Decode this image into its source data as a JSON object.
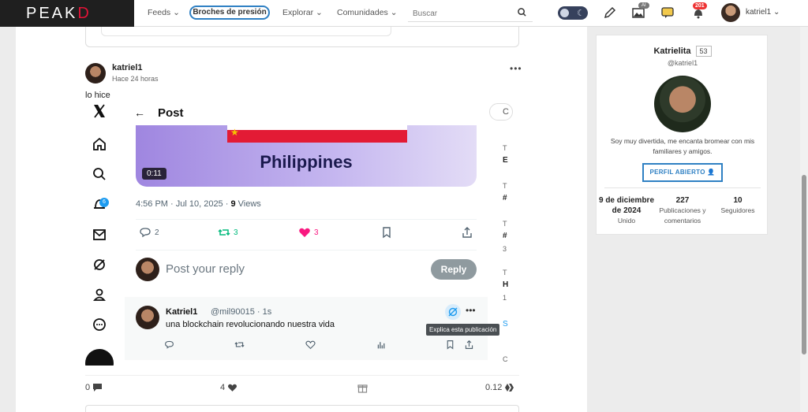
{
  "header": {
    "logo_main": "PEAK",
    "logo_accent": "D",
    "nav": {
      "feeds": "Feeds",
      "pinned": "Broches de presión",
      "explore": "Explorar",
      "communities": "Comunidades"
    },
    "search_placeholder": "Buscar",
    "ai_badge": "AI",
    "notifications_count": "201",
    "username": "katriel1"
  },
  "post": {
    "author": "katriel1",
    "time": "Hace 24 horas",
    "body": "lo hice",
    "embed": {
      "sidebar_badge": "6",
      "title": "Post",
      "video_title": "Philippines",
      "video_duration": "0:11",
      "meta_time": "4:56 PM · Jul 10, 2025 · ",
      "meta_views_count": "9",
      "meta_views_label": " Views",
      "replies": "2",
      "reposts": "3",
      "likes": "3",
      "reply_placeholder": "Post your reply",
      "reply_button": "Reply",
      "reply": {
        "name": "Katriel1",
        "handle": "@mil90015 · 1s",
        "text": "una blockchain revolucionando nuestra vida",
        "tooltip": "Explica esta publicación"
      },
      "right_partial": {
        "button": "C",
        "t1": "T",
        "b1": "E",
        "t2": "T",
        "b2": "#",
        "t3": "T",
        "b3": "#",
        "n3": "3",
        "t4": "T",
        "b4": "H",
        "n4": "1",
        "s5": "S",
        "c6": "C"
      }
    },
    "footer": {
      "comments": "0",
      "votes": "4",
      "payout": "0.12"
    }
  },
  "profile": {
    "name": "Katrielita",
    "reputation": "53",
    "handle": "@katriel1",
    "bio": "Soy muy divertida, me encanta bromear con mis familiares y amigos.",
    "button": "PERFIL ABIERTO",
    "stats": [
      {
        "value": "9 de diciembre de 2024",
        "label": "Unido"
      },
      {
        "value": "227",
        "label": "Publicaciones y comentarios"
      },
      {
        "value": "10",
        "label": "Seguidores"
      }
    ]
  }
}
